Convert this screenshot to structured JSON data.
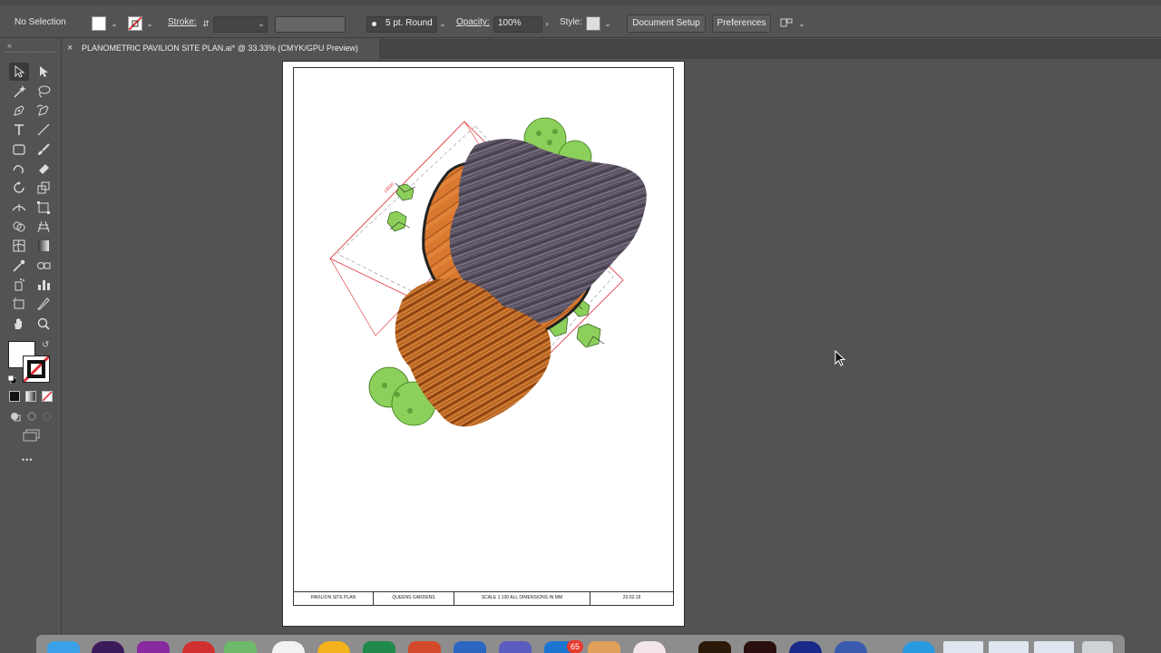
{
  "control_bar": {
    "selection_label": "No Selection",
    "stroke_label": "Stroke:",
    "brush_value": "5 pt. Round",
    "opacity_label": "Opacity:",
    "opacity_value": "100%",
    "style_label": "Style:",
    "document_setup_label": "Document Setup",
    "preferences_label": "Preferences"
  },
  "document_tab": {
    "close_glyph": "×",
    "title": "PLANOMETRIC PAVILION SITE PLAN.ai* @ 33.33% (CMYK/GPU Preview)"
  },
  "title_block": {
    "drawing_title": "PAVILION SITE PLAN",
    "location": "QUEENS GARDENS",
    "scale_note": "SCALE 1:100  ALL DIMENSIONS IN MM",
    "date": "23.02.18"
  },
  "drawing": {
    "dimension_label": "14000"
  },
  "toolbar": {
    "more_glyph": "•••"
  },
  "dock": {
    "mail_badge": "65"
  },
  "colors": {
    "workspace_bg": "#535353",
    "plant_green": "#8ccf5a",
    "deck_orange": "#d9782f",
    "guide_red": "#e0303a"
  }
}
